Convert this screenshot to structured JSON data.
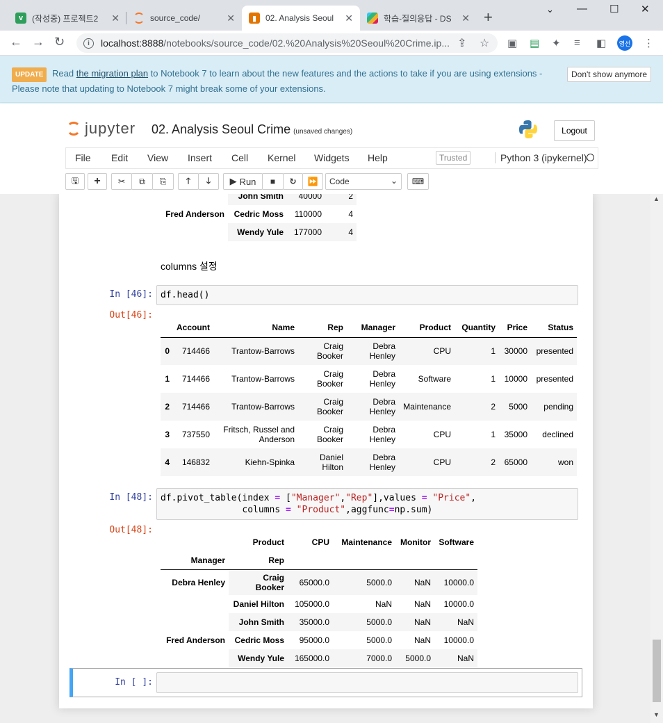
{
  "browser": {
    "tabs": [
      {
        "title": "(작성중) 프로젝트2",
        "fav": "v",
        "color": "#2e9e5b"
      },
      {
        "title": "source_code/",
        "fav": "",
        "color": "#f37726"
      },
      {
        "title": "02. Analysis Seoul",
        "fav": "",
        "color": "#e37400"
      },
      {
        "title": "학습-질의응답 - DS",
        "fav": "",
        "color": "#e01e5a"
      }
    ],
    "url_host": "localhost:8888",
    "url_path": "/notebooks/source_code/02.%20Analysis%20Seoul%20Crime.ip...",
    "profile": "영선"
  },
  "banner": {
    "badge": "UPDATE",
    "text_read": "Read",
    "link": "the migration plan",
    "text_rest": "to Notebook 7 to learn about the new features and the actions to take if you are using extensions -",
    "line2": "Please note that updating to Notebook 7 might break some of your extensions.",
    "dont_show": "Don't show anymore"
  },
  "header": {
    "logo_text": "jupyter",
    "notebook_name": "02. Analysis Seoul Crime",
    "unsaved": "(unsaved changes)",
    "logout": "Logout"
  },
  "menu": {
    "items": [
      "File",
      "Edit",
      "View",
      "Insert",
      "Cell",
      "Kernel",
      "Widgets",
      "Help"
    ],
    "trusted": "Trusted",
    "kernel": "Python 3 (ipykernel)"
  },
  "toolbar": {
    "run": "Run",
    "cell_type": "Code"
  },
  "top_table": {
    "rows": [
      {
        "idx": "",
        "rep": "John Smith",
        "price": "40000",
        "qty": "2"
      },
      {
        "idx": "Fred Anderson",
        "rep": "Cedric Moss",
        "price": "110000",
        "qty": "4"
      },
      {
        "idx": "",
        "rep": "Wendy Yule",
        "price": "177000",
        "qty": "4"
      }
    ]
  },
  "markdown": "columns 설정",
  "cell46": {
    "in_prompt": "In [46]:",
    "out_prompt": "Out[46]:",
    "code": "df.head()",
    "columns": [
      "Account",
      "Name",
      "Rep",
      "Manager",
      "Product",
      "Quantity",
      "Price",
      "Status"
    ],
    "rows": [
      {
        "i": "0",
        "account": "714466",
        "name": "Trantow-Barrows",
        "rep1": "Craig",
        "rep2": "Booker",
        "mgr1": "Debra",
        "mgr2": "Henley",
        "product": "CPU",
        "qty": "1",
        "price": "30000",
        "status": "presented"
      },
      {
        "i": "1",
        "account": "714466",
        "name": "Trantow-Barrows",
        "rep1": "Craig",
        "rep2": "Booker",
        "mgr1": "Debra",
        "mgr2": "Henley",
        "product": "Software",
        "qty": "1",
        "price": "10000",
        "status": "presented"
      },
      {
        "i": "2",
        "account": "714466",
        "name": "Trantow-Barrows",
        "rep1": "Craig",
        "rep2": "Booker",
        "mgr1": "Debra",
        "mgr2": "Henley",
        "product": "Maintenance",
        "qty": "2",
        "price": "5000",
        "status": "pending"
      },
      {
        "i": "3",
        "account": "737550",
        "name": "Fritsch, Russel and Anderson",
        "rep1": "Craig",
        "rep2": "Booker",
        "mgr1": "Debra",
        "mgr2": "Henley",
        "product": "CPU",
        "qty": "1",
        "price": "35000",
        "status": "declined"
      },
      {
        "i": "4",
        "account": "146832",
        "name": "Kiehn-Spinka",
        "rep1": "Daniel",
        "rep2": "Hilton",
        "mgr1": "Debra",
        "mgr2": "Henley",
        "product": "CPU",
        "qty": "2",
        "price": "65000",
        "status": "won"
      }
    ]
  },
  "cell48": {
    "in_prompt": "In [48]:",
    "out_prompt": "Out[48]:",
    "code_line1_a": "df.pivot_table(index ",
    "code_line1_b": "=",
    "code_line1_c": " [",
    "code_line1_s1": "\"Manager\"",
    "code_line1_d": ",",
    "code_line1_s2": "\"Rep\"",
    "code_line1_e": "],values ",
    "code_line1_f": "=",
    "code_line1_g": " ",
    "code_line1_s3": "\"Price\"",
    "code_line1_h": ",",
    "code_line2_a": "               columns ",
    "code_line2_b": "=",
    "code_line2_c": " ",
    "code_line2_s": "\"Product\"",
    "code_line2_d": ",aggfunc",
    "code_line2_e": "=",
    "code_line2_f": "np.sum)",
    "col_header_label": "Product",
    "columns": [
      "CPU",
      "Maintenance",
      "Monitor",
      "Software"
    ],
    "index_names": [
      "Manager",
      "Rep"
    ],
    "rows": [
      {
        "mgr": "Debra Henley",
        "rep": "Craig Booker",
        "vals": [
          "65000.0",
          "5000.0",
          "NaN",
          "10000.0"
        ]
      },
      {
        "mgr": "",
        "rep": "Daniel Hilton",
        "vals": [
          "105000.0",
          "NaN",
          "NaN",
          "10000.0"
        ]
      },
      {
        "mgr": "",
        "rep": "John Smith",
        "vals": [
          "35000.0",
          "5000.0",
          "NaN",
          "NaN"
        ]
      },
      {
        "mgr": "Fred Anderson",
        "rep": "Cedric Moss",
        "vals": [
          "95000.0",
          "5000.0",
          "NaN",
          "10000.0"
        ]
      },
      {
        "mgr": "",
        "rep": "Wendy Yule",
        "vals": [
          "165000.0",
          "7000.0",
          "5000.0",
          "NaN"
        ]
      }
    ]
  },
  "empty_cell": {
    "in_prompt": "In [ ]:"
  }
}
